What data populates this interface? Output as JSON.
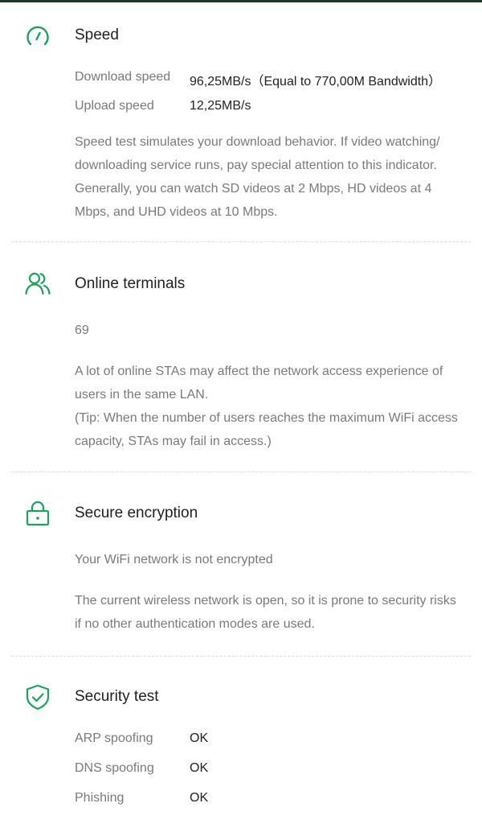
{
  "theme": {
    "accent": "#1aa45a"
  },
  "speed": {
    "icon": "speedometer-icon",
    "title": "Speed",
    "download_label": "Download speed",
    "download_value": "96,25MB/s（Equal to 770,00M Bandwidth）",
    "upload_label": "Upload speed",
    "upload_value": "12,25MB/s",
    "description": "Speed test simulates your download behavior. If video watching/ downloading service runs, pay special attention to this indicator. Generally, you can watch SD videos at 2 Mbps, HD videos at 4 Mbps, and UHD videos at 10 Mbps."
  },
  "terminals": {
    "icon": "users-icon",
    "title": "Online terminals",
    "count": "69",
    "description_line1": "A lot of online STAs may affect the network access experience of users in the same LAN.",
    "description_line2": "(Tip: When the number of users reaches the maximum WiFi access capacity, STAs may fail in access.)"
  },
  "encryption": {
    "icon": "lock-icon",
    "title": "Secure encryption",
    "status": "Your WiFi network is not encrypted",
    "description": "The current wireless network is open, so it is prone to security risks if no other authentication modes are used."
  },
  "security": {
    "icon": "shield-check-icon",
    "title": "Security test",
    "items": [
      {
        "label": "ARP spoofing",
        "value": "OK"
      },
      {
        "label": "DNS spoofing",
        "value": "OK"
      },
      {
        "label": "Phishing",
        "value": "OK"
      }
    ]
  }
}
